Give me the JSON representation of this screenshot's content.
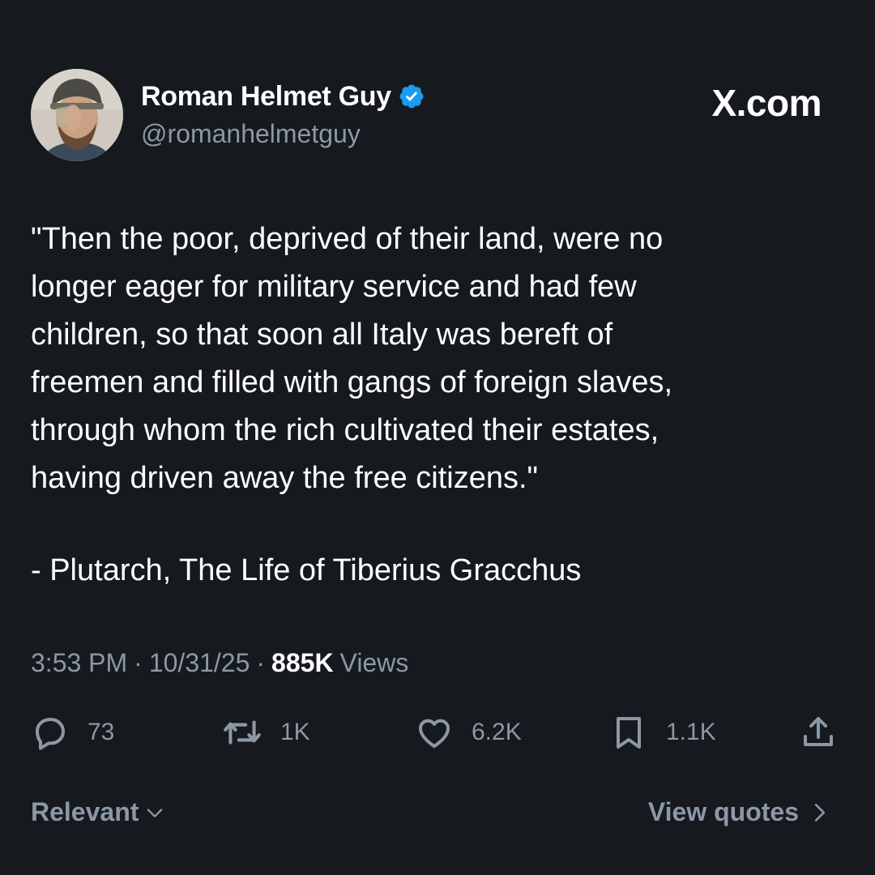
{
  "header": {
    "display_name": "Roman Helmet Guy",
    "handle": "@romanhelmetguy",
    "verified": true,
    "brand": "X.com",
    "avatar_icon": "avatar-photo"
  },
  "tweet": {
    "text": "\"Then the poor, deprived of their land, were no\nlonger eager for military service and had few\nchildren, so that soon all Italy was bereft of\nfreemen and filled with gangs of foreign slaves,\nthrough whom the rich cultivated their estates,\nhaving driven away the free citizens.\"",
    "attribution": "- Plutarch, The Life of Tiberius Gracchus"
  },
  "meta": {
    "time": "3:53 PM",
    "separator": "·",
    "date": "10/31/25",
    "views_count": "885K",
    "views_label": "Views"
  },
  "actions": {
    "replies": {
      "icon": "reply-icon",
      "count": "73"
    },
    "retweets": {
      "icon": "retweet-icon",
      "count": "1K"
    },
    "likes": {
      "icon": "heart-icon",
      "count": "6.2K"
    },
    "bookmarks": {
      "icon": "bookmark-icon",
      "count": "1.1K"
    },
    "share": {
      "icon": "share-icon"
    }
  },
  "footer": {
    "sort_label": "Relevant",
    "view_quotes_label": "View quotes"
  },
  "colors": {
    "background": "#16191e",
    "text": "#ffffff",
    "muted": "#8b98a5",
    "verified": "#1d9bf0"
  }
}
